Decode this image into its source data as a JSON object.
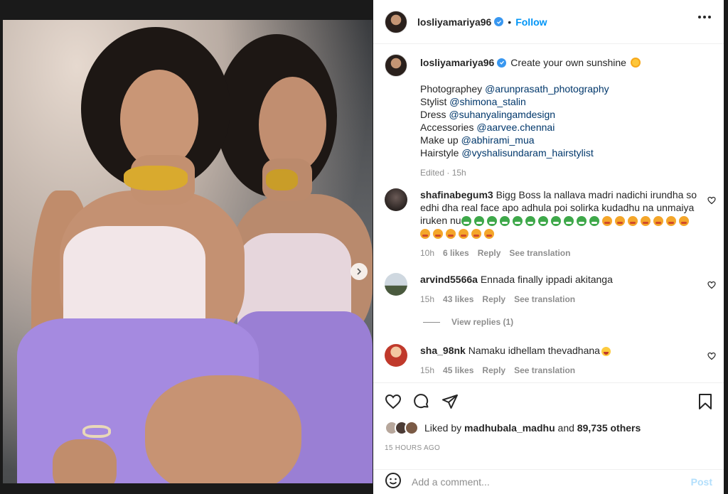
{
  "post": {
    "username": "losliyamariya96",
    "follow_label": "Follow",
    "separator": "•",
    "caption": "Create your own sunshine",
    "credits": [
      {
        "label": "Photographey ",
        "handle": "@arunprasath_photography"
      },
      {
        "label": "Stylist ",
        "handle": "@shimona_stalin"
      },
      {
        "label": "Dress ",
        "handle": "@suhanyalingamdesign"
      },
      {
        "label": "Accessories ",
        "handle": "@aarvee.chennai"
      },
      {
        "label": "Make up ",
        "handle": "@abhirami_mua"
      },
      {
        "label": "Hairstyle ",
        "handle": "@vyshalisundaram_hairstylist"
      }
    ],
    "caption_meta": "Edited · 15h"
  },
  "comments": [
    {
      "user": "shafinabegum3",
      "text": "Bigg Boss la nallava madri nadichi irundha so edhi dha real face apo adhula poi solirka kudadhu na unmaiya iruken nu",
      "time": "10h",
      "likes": "6 likes",
      "reply": "Reply",
      "translate": "See translation"
    },
    {
      "user": "arvind5566a",
      "text": "Ennada finally ippadi akitanga",
      "time": "15h",
      "likes": "43 likes",
      "reply": "Reply",
      "translate": "See translation"
    },
    {
      "user": "sha_98nk",
      "text": "Namaku idhellam thevadhana",
      "time": "15h",
      "likes": "45 likes",
      "reply": "Reply",
      "translate": "See translation"
    }
  ],
  "view_replies": "View replies (1)",
  "likes": {
    "prefix": "Liked by ",
    "user": "madhubala_madhu",
    "middle": " and ",
    "count": "89,735 others"
  },
  "timestamp": "15 HOURS AGO",
  "add_comment": {
    "placeholder": "Add a comment...",
    "post_label": "Post"
  },
  "carousel": {
    "current": 1,
    "total": 2
  },
  "colors": {
    "accent": "#0095f6",
    "link": "#00376b",
    "verified": "#3897f0",
    "muted": "#8e8e8e"
  },
  "icons": [
    "verified-badge-icon",
    "more-options-icon",
    "heart-icon",
    "comment-icon",
    "share-icon",
    "bookmark-icon",
    "emoji-icon",
    "chevron-right-icon",
    "sun-emoji-icon"
  ]
}
